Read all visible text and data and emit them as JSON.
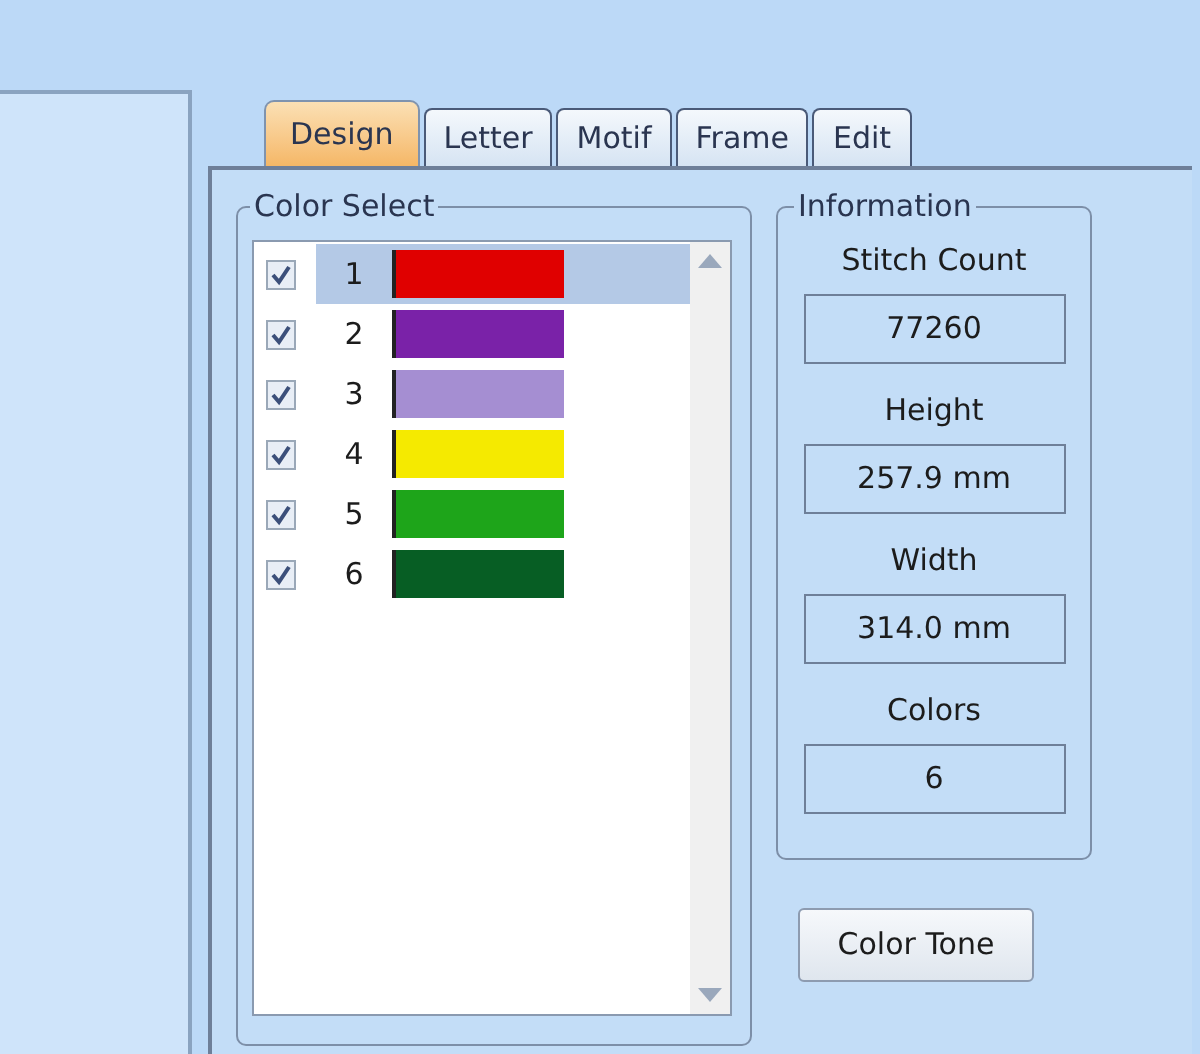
{
  "tabs": [
    {
      "label": "Design",
      "selected": true
    },
    {
      "label": "Letter",
      "selected": false
    },
    {
      "label": "Motif",
      "selected": false
    },
    {
      "label": "Frame",
      "selected": false
    },
    {
      "label": "Edit",
      "selected": false
    }
  ],
  "color_select": {
    "title": "Color Select",
    "items": [
      {
        "number": "1",
        "color": "#e00000",
        "checked": true,
        "selected": true
      },
      {
        "number": "2",
        "color": "#7a22a8",
        "checked": true,
        "selected": false
      },
      {
        "number": "3",
        "color": "#a58ed2",
        "checked": true,
        "selected": false
      },
      {
        "number": "4",
        "color": "#f5ea00",
        "checked": true,
        "selected": false
      },
      {
        "number": "5",
        "color": "#1ea51a",
        "checked": true,
        "selected": false
      },
      {
        "number": "6",
        "color": "#075e24",
        "checked": true,
        "selected": false
      }
    ]
  },
  "information": {
    "title": "Information",
    "fields": [
      {
        "label": "Stitch Count",
        "value": "77260"
      },
      {
        "label": "Height",
        "value": "257.9 mm"
      },
      {
        "label": "Width",
        "value": "314.0 mm"
      },
      {
        "label": "Colors",
        "value": "6"
      }
    ]
  },
  "color_tone_button": "Color Tone"
}
